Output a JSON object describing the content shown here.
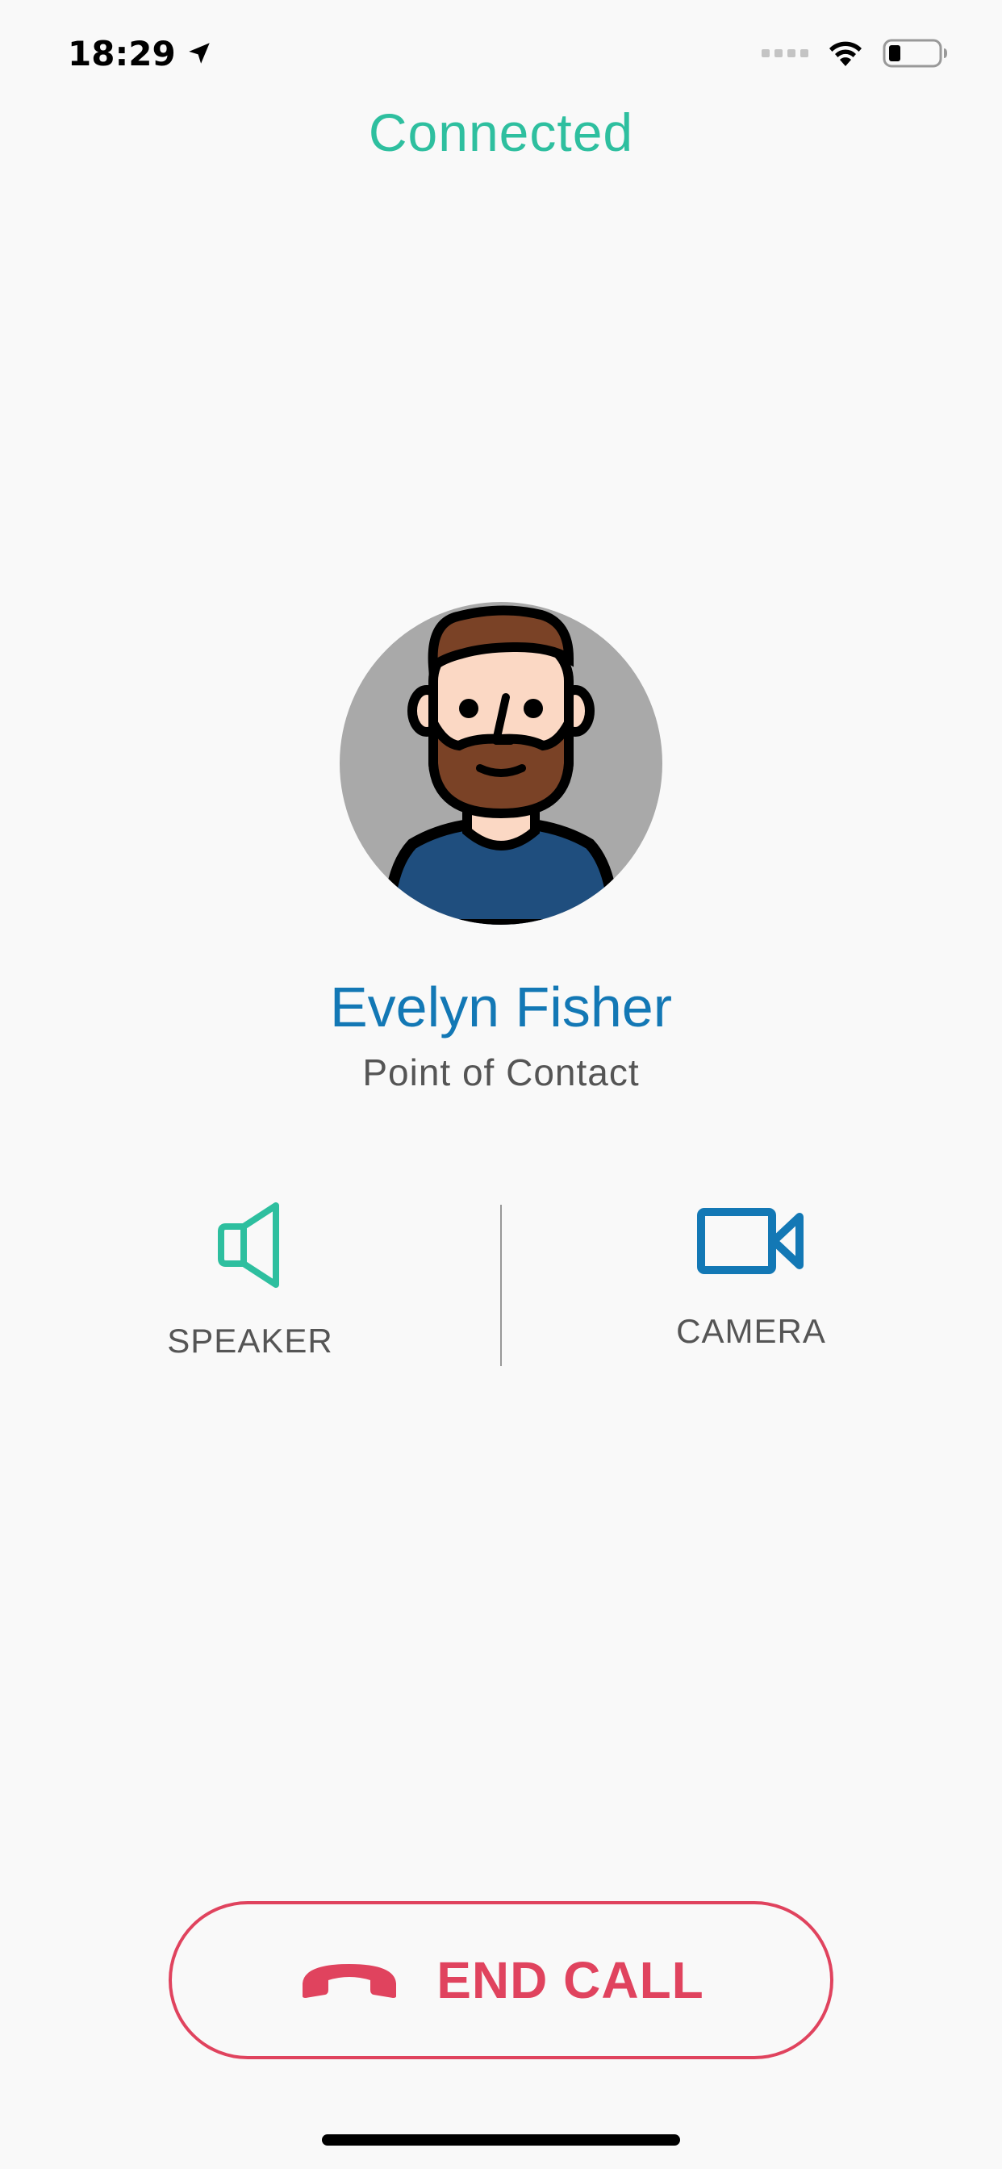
{
  "status_bar": {
    "time": "18:29",
    "location_icon": "location-arrow-icon",
    "wifi_icon": "wifi-icon",
    "battery_icon": "battery-low-icon"
  },
  "call": {
    "status": "Connected",
    "status_color": "#2ebf9f"
  },
  "contact": {
    "name": "Evelyn Fisher",
    "role": "Point of Contact",
    "avatar_icon": "bearded-man-avatar-icon"
  },
  "controls": {
    "speaker": {
      "label": "SPEAKER",
      "icon": "speaker-icon",
      "color": "#2ebf9f"
    },
    "camera": {
      "label": "CAMERA",
      "icon": "video-camera-icon",
      "color": "#1378b5"
    }
  },
  "end_call": {
    "label": "END CALL",
    "icon": "phone-hangup-icon",
    "color": "#e0435e"
  }
}
